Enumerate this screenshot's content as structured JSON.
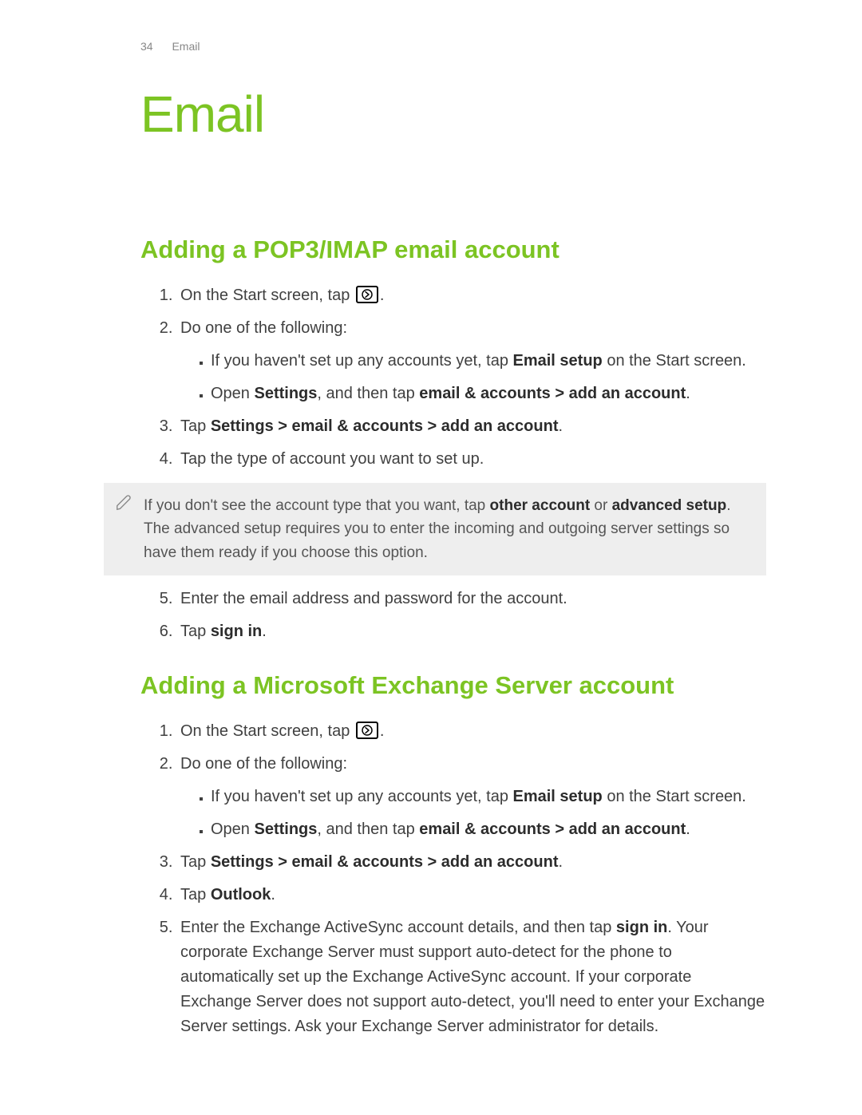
{
  "header": {
    "page_number": "34",
    "section": "Email"
  },
  "chapter_title": "Email",
  "section1": {
    "title": "Adding a POP3/IMAP email account",
    "step1_pre": "On the Start screen, tap",
    "step1_post": ".",
    "step2": "Do one of the following:",
    "step2a_pre": "If you haven't set up any accounts yet, tap ",
    "step2a_bold": "Email setup",
    "step2a_post": " on the Start screen.",
    "step2b_pre": "Open ",
    "step2b_b1": "Settings",
    "step2b_mid": ", and then tap ",
    "step2b_b2": "email & accounts > add an account",
    "step2b_post": ".",
    "step3_pre": "Tap ",
    "step3_b": "Settings > email & accounts > add an account",
    "step3_post": ".",
    "step4": "Tap the type of account you want to set up.",
    "note_pre": "If you don't see the account type that you want, tap ",
    "note_b1": "other account",
    "note_mid": " or ",
    "note_b2": "advanced setup",
    "note_post": ". The advanced setup requires you to enter the incoming and outgoing server settings so have them ready if you choose this option.",
    "step5": "Enter the email address and password for the account.",
    "step6_pre": "Tap ",
    "step6_b": "sign in",
    "step6_post": "."
  },
  "section2": {
    "title": "Adding a Microsoft Exchange Server account",
    "step1_pre": "On the Start screen, tap",
    "step1_post": ".",
    "step2": "Do one of the following:",
    "step2a_pre": "If you haven't set up any accounts yet, tap ",
    "step2a_bold": "Email setup",
    "step2a_post": " on the Start screen.",
    "step2b_pre": "Open ",
    "step2b_b1": "Settings",
    "step2b_mid": ", and then tap ",
    "step2b_b2": "email & accounts > add an account",
    "step2b_post": ".",
    "step3_pre": "Tap ",
    "step3_b": "Settings > email & accounts > add an account",
    "step3_post": ".",
    "step4_pre": "Tap ",
    "step4_b": "Outlook",
    "step4_post": ".",
    "step5_pre": "Enter the Exchange ActiveSync account details, and then tap ",
    "step5_b": "sign in",
    "step5_post": ". Your corporate Exchange Server must support auto-detect for the phone to automatically set up the Exchange ActiveSync account. If your corporate Exchange Server does not support auto-detect, you'll need to enter your Exchange Server settings. Ask your Exchange Server administrator for details."
  }
}
